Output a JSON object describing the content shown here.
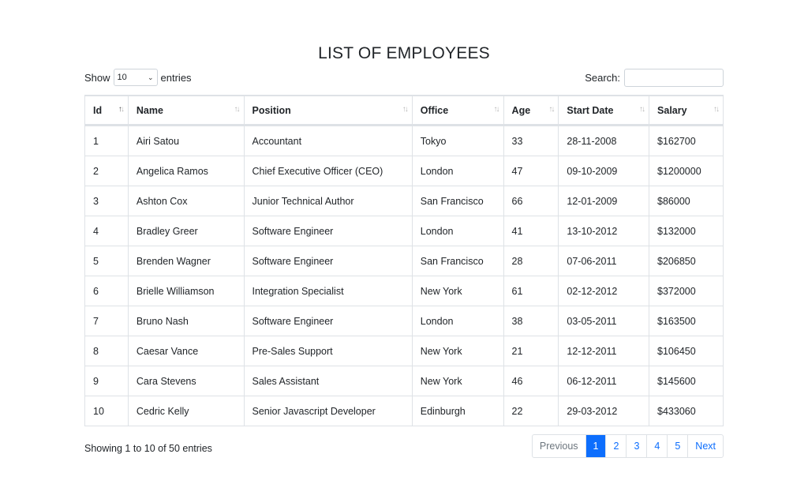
{
  "page": {
    "title": "LIST OF EMPLOYEES"
  },
  "length_control": {
    "show_label": "Show",
    "selected": "10",
    "entries_label": "entries"
  },
  "search": {
    "label": "Search:",
    "value": "",
    "placeholder": ""
  },
  "table": {
    "columns": [
      {
        "label": "Id",
        "sort": "asc"
      },
      {
        "label": "Name",
        "sort": "none"
      },
      {
        "label": "Position",
        "sort": "none"
      },
      {
        "label": "Office",
        "sort": "none"
      },
      {
        "label": "Age",
        "sort": "none"
      },
      {
        "label": "Start Date",
        "sort": "none"
      },
      {
        "label": "Salary",
        "sort": "none"
      }
    ],
    "rows": [
      [
        "1",
        "Airi Satou",
        "Accountant",
        "Tokyo",
        "33",
        "28-11-2008",
        "$162700"
      ],
      [
        "2",
        "Angelica Ramos",
        "Chief Executive Officer (CEO)",
        "London",
        "47",
        "09-10-2009",
        "$1200000"
      ],
      [
        "3",
        "Ashton Cox",
        "Junior Technical Author",
        "San Francisco",
        "66",
        "12-01-2009",
        "$86000"
      ],
      [
        "4",
        "Bradley Greer",
        "Software Engineer",
        "London",
        "41",
        "13-10-2012",
        "$132000"
      ],
      [
        "5",
        "Brenden Wagner",
        "Software Engineer",
        "San Francisco",
        "28",
        "07-06-2011",
        "$206850"
      ],
      [
        "6",
        "Brielle Williamson",
        "Integration Specialist",
        "New York",
        "61",
        "02-12-2012",
        "$372000"
      ],
      [
        "7",
        "Bruno Nash",
        "Software Engineer",
        "London",
        "38",
        "03-05-2011",
        "$163500"
      ],
      [
        "8",
        "Caesar Vance",
        "Pre-Sales Support",
        "New York",
        "21",
        "12-12-2011",
        "$106450"
      ],
      [
        "9",
        "Cara Stevens",
        "Sales Assistant",
        "New York",
        "46",
        "06-12-2011",
        "$145600"
      ],
      [
        "10",
        "Cedric Kelly",
        "Senior Javascript Developer",
        "Edinburgh",
        "22",
        "29-03-2012",
        "$433060"
      ]
    ]
  },
  "footer": {
    "info": "Showing 1 to 10 of 50 entries"
  },
  "pagination": {
    "previous": "Previous",
    "pages": [
      "1",
      "2",
      "3",
      "4",
      "5"
    ],
    "active": "1",
    "next": "Next"
  },
  "colors": {
    "accent": "#0d6efd",
    "border": "#dee2e6",
    "muted": "#6c757d"
  },
  "icons": {
    "sort": "sort-arrows-icon",
    "dropdown": "chevron-down-icon"
  }
}
